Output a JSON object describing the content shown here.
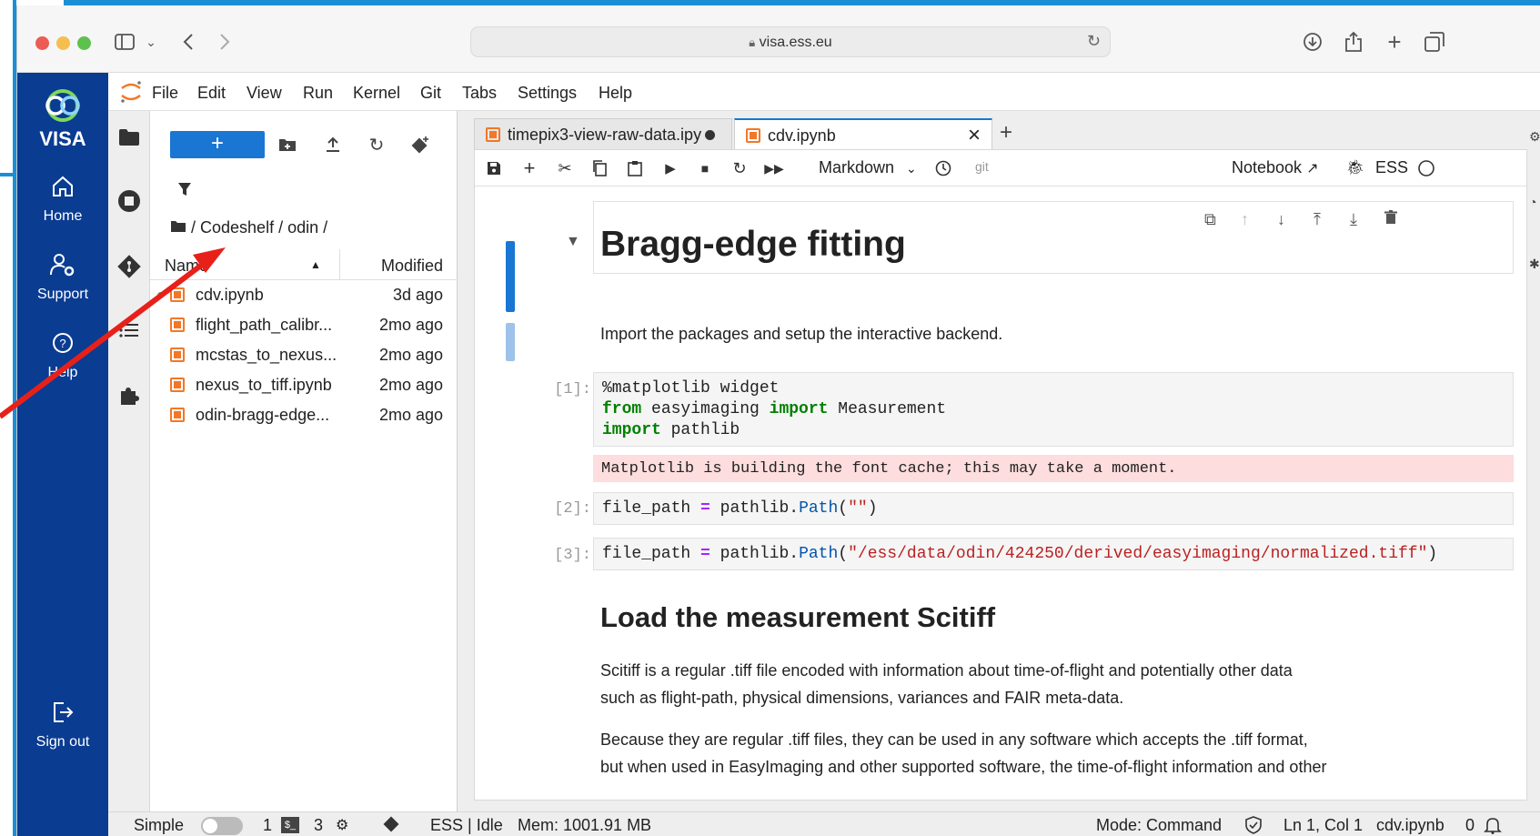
{
  "browser": {
    "url": "visa.ess.eu"
  },
  "visa": {
    "title": "VISA",
    "items": [
      {
        "label": "Home",
        "icon": "home-icon"
      },
      {
        "label": "Support",
        "icon": "support-icon"
      },
      {
        "label": "Help",
        "icon": "help-icon"
      },
      {
        "label": "Sign out",
        "icon": "sign-out-icon"
      }
    ]
  },
  "menu": [
    "File",
    "Edit",
    "View",
    "Run",
    "Kernel",
    "Git",
    "Tabs",
    "Settings",
    "Help"
  ],
  "filebrowser": {
    "new_label": "+",
    "breadcrumb": "/ Codeshelf / odin /",
    "col_name": "Name",
    "col_modified": "Modified",
    "files": [
      {
        "name": "cdv.ipynb",
        "modified": "3d ago"
      },
      {
        "name": "flight_path_calibr...",
        "modified": "2mo ago"
      },
      {
        "name": "mcstas_to_nexus...",
        "modified": "2mo ago"
      },
      {
        "name": "nexus_to_tiff.ipynb",
        "modified": "2mo ago"
      },
      {
        "name": "odin-bragg-edge...",
        "modified": "2mo ago"
      }
    ]
  },
  "tabs": [
    {
      "label": "timepix3-view-raw-data.ipy"
    },
    {
      "label": "cdv.ipynb"
    }
  ],
  "toolbar": {
    "cell_type": "Markdown",
    "git": "git",
    "notebook": "Notebook",
    "kernel": "ESS"
  },
  "notebook": {
    "heading1": "Bragg-edge fitting",
    "intro": "Import the packages and setup the interactive backend.",
    "prompt1": "[1]:",
    "prompt2": "[2]:",
    "prompt3": "[3]:",
    "stderr": "Matplotlib is building the font cache; this may take a moment.",
    "heading2": "Load the measurement Scitiff",
    "para1_line1": "Scitiff is a regular .tiff file encoded with information about time-of-flight and potentially other data",
    "para1_line2": "such as flight-path, physical dimensions, variances and FAIR meta-data.",
    "para2_line1": "Because they are regular .tiff files, they can be used in any software which accepts the .tiff format,",
    "para2_line2": "but when used in EasyImaging and other supported software, the time-of-flight information and other"
  },
  "code": {
    "c1_l1": "%matplotlib widget",
    "c1_from": "from",
    "c1_mod": " easyimaging ",
    "c1_import": "import",
    "c1_cls": " Measurement",
    "c1_import2": "import",
    "c1_lib": " pathlib",
    "c2_var": "file_path ",
    "c2_eq": "=",
    "c2_call": " pathlib.",
    "c2_attr": "Path",
    "c2_open": "(",
    "c2_str": "\"\"",
    "c2_close": ")",
    "c3_str": "\"/ess/data/odin/424250/derived/easyimaging/normalized.tiff\""
  },
  "status": {
    "mode_simple": "Simple",
    "terminals": "1",
    "kernels": "3",
    "kernel_status": "ESS | Idle",
    "memory": "Mem: 1001.91 MB",
    "mode": "Mode: Command",
    "cursor": "Ln 1, Col 1",
    "file": "cdv.ipynb",
    "notifications": "0"
  },
  "colors": {
    "visa_sidebar": "#0a3c92",
    "accent": "#1976d2",
    "frame": "#1a8fd6",
    "annotation_arrow": "#e8201a"
  }
}
